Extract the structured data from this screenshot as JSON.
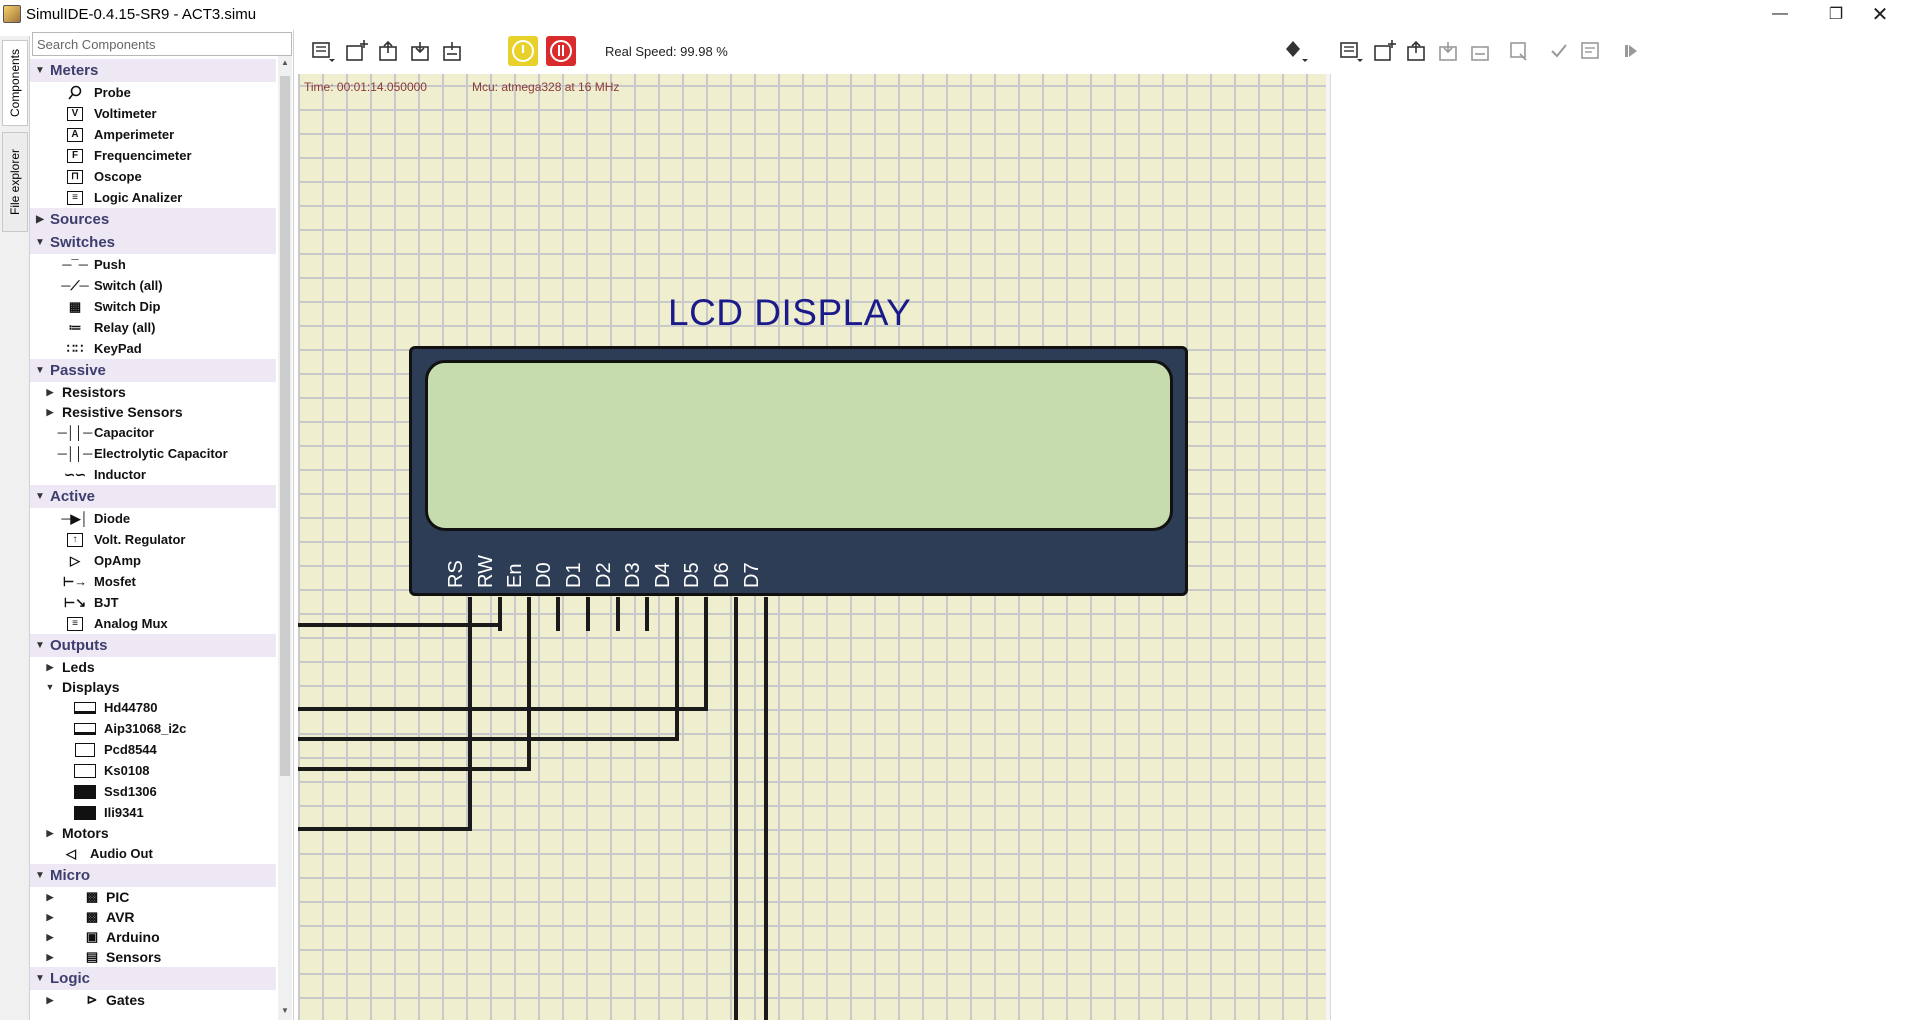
{
  "window": {
    "title": "SimulIDE-0.4.15-SR9  -  ACT3.simu",
    "minimize_icon": "minimize-icon",
    "maximize_icon": "restore-icon",
    "close_icon": "close-icon"
  },
  "side_tabs": {
    "components": "Components",
    "file_explorer": "File explorer"
  },
  "search": {
    "placeholder": "Search Components"
  },
  "tree": {
    "meters": {
      "label": "Meters",
      "items": [
        "Probe",
        "Voltimeter",
        "Amperimeter",
        "Frequencimeter",
        "Oscope",
        "Logic Analizer"
      ]
    },
    "sources": {
      "label": "Sources"
    },
    "switches": {
      "label": "Switches",
      "items": [
        "Push",
        "Switch (all)",
        "Switch Dip",
        "Relay (all)",
        "KeyPad"
      ]
    },
    "passive": {
      "label": "Passive",
      "subgroups": [
        "Resistors",
        "Resistive Sensors"
      ],
      "items": [
        "Capacitor",
        "Electrolytic Capacitor",
        "Inductor"
      ]
    },
    "active": {
      "label": "Active",
      "items": [
        "Diode",
        "Volt. Regulator",
        "OpAmp",
        "Mosfet",
        "BJT",
        "Analog Mux"
      ]
    },
    "outputs": {
      "label": "Outputs",
      "leds": "Leds",
      "displays": "Displays",
      "display_items": [
        "Hd44780",
        "Aip31068_i2c",
        "Pcd8544",
        "Ks0108",
        "Ssd1306",
        "Ili9341"
      ],
      "motors": "Motors",
      "audio_out": "Audio Out"
    },
    "micro": {
      "label": "Micro",
      "items": [
        "PIC",
        "AVR",
        "Arduino",
        "Sensors"
      ]
    },
    "logic": {
      "label": "Logic",
      "items": [
        "Gates"
      ]
    }
  },
  "toolbar": {
    "real_speed": "Real Speed: 99.98 %",
    "power_color": "#e8d12a",
    "stop_color": "#d92b2b"
  },
  "canvas": {
    "time": "Time: 00:01:14.050000",
    "mcu": "Mcu: atmega328 at 16 MHz",
    "lcd_title": "LCD DISPLAY",
    "pins": [
      "RS",
      "RW",
      "En",
      "D0",
      "D1",
      "D2",
      "D3",
      "D4",
      "D5",
      "D6",
      "D7"
    ]
  }
}
